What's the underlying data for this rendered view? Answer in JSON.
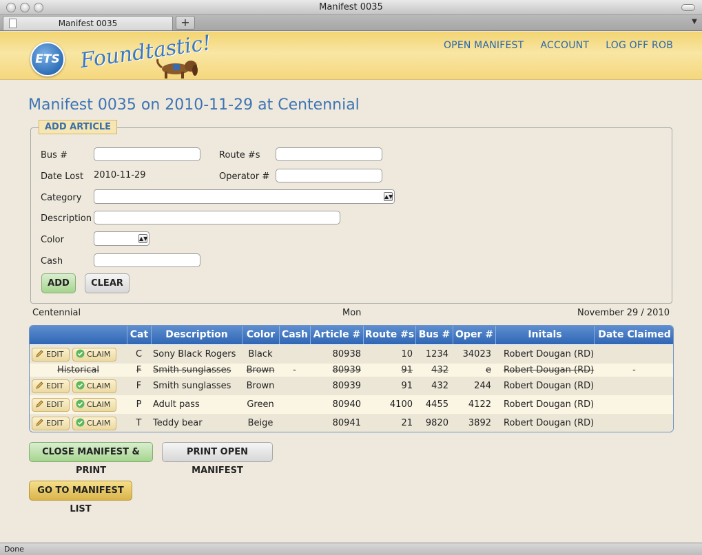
{
  "window": {
    "title": "Manifest 0035",
    "tab_label": "Manifest 0035",
    "new_tab": "+",
    "status": "Done"
  },
  "header": {
    "logo_text": "ETS",
    "brand": "Foundtastic!",
    "nav": [
      "OPEN MANIFEST",
      "ACCOUNT",
      "LOG OFF ROB"
    ]
  },
  "page_title": "Manifest 0035 on 2010-11-29 at Centennial",
  "form": {
    "legend": "ADD ARTICLE",
    "bus_label": "Bus #",
    "route_label": "Route #s",
    "date_label": "Date Lost",
    "date_value": "2010-11-29",
    "operator_label": "Operator #",
    "category_label": "Category",
    "description_label": "Description",
    "color_label": "Color",
    "cash_label": "Cash",
    "add_label": "ADD",
    "clear_label": "CLEAR"
  },
  "meta": {
    "location": "Centennial",
    "weekday": "Mon",
    "date": "November 29 / 2010"
  },
  "table": {
    "headers": [
      "Cat",
      "Description",
      "Color",
      "Cash",
      "Article #",
      "Route #s",
      "Bus #",
      "Oper #",
      "Initals",
      "Date Claimed"
    ],
    "edit_label": "EDIT",
    "claim_label": "CLAIM",
    "rows": [
      {
        "status": "",
        "cat": "C",
        "desc": "Sony Black Rogers",
        "color": "Black",
        "cash": "",
        "article": "80938",
        "route": "10",
        "bus": "1234",
        "oper": "34023",
        "initials": "Robert Dougan (RD)",
        "claimed": ""
      },
      {
        "status": "Historical",
        "cat": "F",
        "desc": "Smith sunglasses",
        "color": "Brown",
        "cash": "-",
        "article": "80939",
        "route": "91",
        "bus": "432",
        "oper": "e",
        "initials": "Robert Dougan (RD)",
        "claimed": "-"
      },
      {
        "status": "",
        "cat": "F",
        "desc": "Smith sunglasses",
        "color": "Brown",
        "cash": "",
        "article": "80939",
        "route": "91",
        "bus": "432",
        "oper": "244",
        "initials": "Robert Dougan (RD)",
        "claimed": ""
      },
      {
        "status": "",
        "cat": "P",
        "desc": "Adult pass",
        "color": "Green",
        "cash": "",
        "article": "80940",
        "route": "4100",
        "bus": "4455",
        "oper": "4122",
        "initials": "Robert Dougan (RD)",
        "claimed": ""
      },
      {
        "status": "",
        "cat": "T",
        "desc": "Teddy bear",
        "color": "Beige",
        "cash": "",
        "article": "80941",
        "route": "21",
        "bus": "9820",
        "oper": "3892",
        "initials": "Robert Dougan (RD)",
        "claimed": ""
      }
    ]
  },
  "actions": {
    "close_print": "CLOSE MANIFEST & PRINT",
    "print_open": "PRINT OPEN MANIFEST",
    "go_list": "GO TO MANIFEST LIST"
  },
  "colors": {
    "accent_blue": "#3d74b5",
    "header_gold": "#f3d472",
    "table_header": "#2f66b4"
  }
}
